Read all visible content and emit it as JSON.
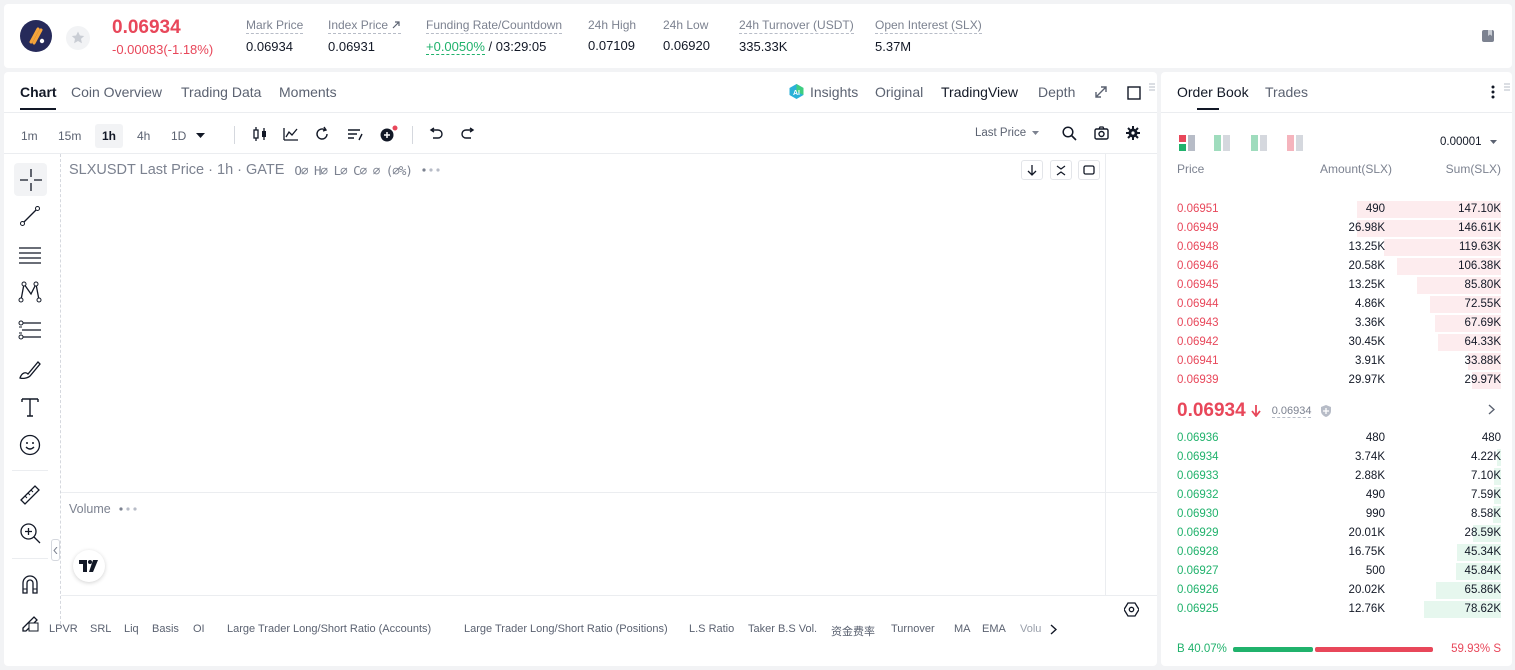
{
  "ticker": {
    "price": "0.06934",
    "change": "-0.00083(-1.18%)",
    "stats": [
      {
        "label": "Mark Price",
        "value": "0.06934"
      },
      {
        "label": "Index Price",
        "value": "0.06931"
      },
      {
        "label": "Funding Rate/Countdown",
        "rate": "+0.0050%",
        "countdown": "/ 03:29:05"
      },
      {
        "label": "24h High",
        "value": "0.07109"
      },
      {
        "label": "24h Low",
        "value": "0.06920"
      },
      {
        "label": "24h Turnover (USDT)",
        "value": "335.33K"
      },
      {
        "label": "Open Interest (SLX)",
        "value": "5.37M"
      }
    ]
  },
  "chart_tabs": [
    "Chart",
    "Coin Overview",
    "Trading Data",
    "Moments"
  ],
  "view_tabs": {
    "insights": "Insights",
    "original": "Original",
    "tradingview": "TradingView",
    "depth": "Depth"
  },
  "timeframes": [
    "1m",
    "15m",
    "1h",
    "4h",
    "1D"
  ],
  "price_type": "Last Price",
  "legend": {
    "symbol": "SLXUSDT Last Price · 1h · GATE",
    "ohlc": "O∅ H∅ L∅ C∅ ∅ (∅%)",
    "volume": "Volume"
  },
  "indicators": [
    "LPVR",
    "SRL",
    "Liq",
    "Basis",
    "OI",
    "Large Trader Long/Short Ratio (Accounts)",
    "Large Trader Long/Short Ratio (Positions)",
    "L.S Ratio",
    "Taker B.S Vol.",
    "资金费率",
    "Turnover",
    "MA",
    "EMA",
    "Volu"
  ],
  "orderbook": {
    "tabs": [
      "Order Book",
      "Trades"
    ],
    "precision": "0.00001",
    "headers": {
      "price": "Price",
      "amount": "Amount(SLX)",
      "sum": "Sum(SLX)"
    },
    "asks": [
      {
        "price": "0.06951",
        "amount": "490",
        "sum": "147.10K",
        "depth": 147.1
      },
      {
        "price": "0.06949",
        "amount": "26.98K",
        "sum": "146.61K",
        "depth": 146.61
      },
      {
        "price": "0.06948",
        "amount": "13.25K",
        "sum": "119.63K",
        "depth": 119.63
      },
      {
        "price": "0.06946",
        "amount": "20.58K",
        "sum": "106.38K",
        "depth": 106.38
      },
      {
        "price": "0.06945",
        "amount": "13.25K",
        "sum": "85.80K",
        "depth": 85.8
      },
      {
        "price": "0.06944",
        "amount": "4.86K",
        "sum": "72.55K",
        "depth": 72.55
      },
      {
        "price": "0.06943",
        "amount": "3.36K",
        "sum": "67.69K",
        "depth": 67.69
      },
      {
        "price": "0.06942",
        "amount": "30.45K",
        "sum": "64.33K",
        "depth": 64.33
      },
      {
        "price": "0.06941",
        "amount": "3.91K",
        "sum": "33.88K",
        "depth": 33.88
      },
      {
        "price": "0.06939",
        "amount": "29.97K",
        "sum": "29.97K",
        "depth": 29.97
      }
    ],
    "last_price": "0.06934",
    "mark_price": "0.06934",
    "bids": [
      {
        "price": "0.06936",
        "amount": "480",
        "sum": "480",
        "depth": 0.48
      },
      {
        "price": "0.06934",
        "amount": "3.74K",
        "sum": "4.22K",
        "depth": 4.22
      },
      {
        "price": "0.06933",
        "amount": "2.88K",
        "sum": "7.10K",
        "depth": 7.1
      },
      {
        "price": "0.06932",
        "amount": "490",
        "sum": "7.59K",
        "depth": 7.59
      },
      {
        "price": "0.06930",
        "amount": "990",
        "sum": "8.58K",
        "depth": 8.58
      },
      {
        "price": "0.06929",
        "amount": "20.01K",
        "sum": "28.59K",
        "depth": 28.59
      },
      {
        "price": "0.06928",
        "amount": "16.75K",
        "sum": "45.34K",
        "depth": 45.34
      },
      {
        "price": "0.06927",
        "amount": "500",
        "sum": "45.84K",
        "depth": 45.84
      },
      {
        "price": "0.06926",
        "amount": "20.02K",
        "sum": "65.86K",
        "depth": 65.86
      },
      {
        "price": "0.06925",
        "amount": "12.76K",
        "sum": "78.62K",
        "depth": 78.62
      }
    ],
    "buy_ratio": "40.07%",
    "sell_ratio": "59.93%",
    "buy_label": "B",
    "sell_label": "S",
    "buy_fraction": 0.4007
  },
  "colors": {
    "up": "#20b26c",
    "down": "#e8475a",
    "ask_bg": "#fdecee",
    "bid_bg": "#e6f7ee"
  }
}
